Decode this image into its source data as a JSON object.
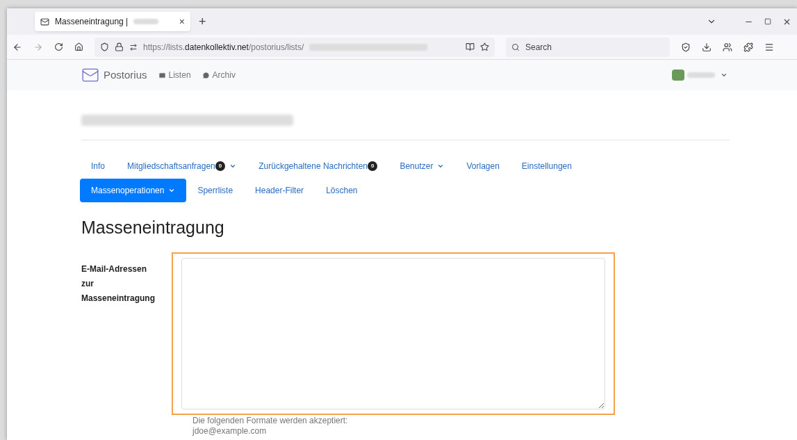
{
  "browser": {
    "tab": {
      "title": "Masseneintragung |",
      "close": "×"
    },
    "new_tab": "+",
    "url": {
      "prefix": "https://lists.",
      "domain": "datenkollektiv.net",
      "path": "/postorius/lists/"
    },
    "search": {
      "placeholder": "Search"
    }
  },
  "navbar": {
    "brand": "Postorius",
    "links": [
      {
        "label": "Listen"
      },
      {
        "label": "Archiv"
      }
    ]
  },
  "tab_rows": [
    [
      {
        "label": "Info",
        "selected": false,
        "dropdown": false
      },
      {
        "label": "Mitgliedschaftsanfragen",
        "badge": "0",
        "selected": false,
        "dropdown": true
      },
      {
        "label": "Zurückgehaltene Nachrichten",
        "badge": "0",
        "selected": false,
        "dropdown": false
      },
      {
        "label": "Benutzer",
        "selected": false,
        "dropdown": true
      },
      {
        "label": "Vorlagen",
        "selected": false,
        "dropdown": false
      },
      {
        "label": "Einstellungen",
        "selected": false,
        "dropdown": false
      }
    ],
    [
      {
        "label": "Massenoperationen",
        "selected": true,
        "dropdown": true
      },
      {
        "label": "Sperrliste",
        "selected": false,
        "dropdown": false
      },
      {
        "label": "Header-Filter",
        "selected": false,
        "dropdown": false
      },
      {
        "label": "Löschen",
        "selected": false,
        "dropdown": false
      }
    ]
  ],
  "heading": "Masseneintragung",
  "form": {
    "label": "E-Mail-Adressen zur Masseneintragung",
    "help": [
      "Die folgenden Formate werden akzeptiert:",
      "jdoe@example.com"
    ]
  }
}
